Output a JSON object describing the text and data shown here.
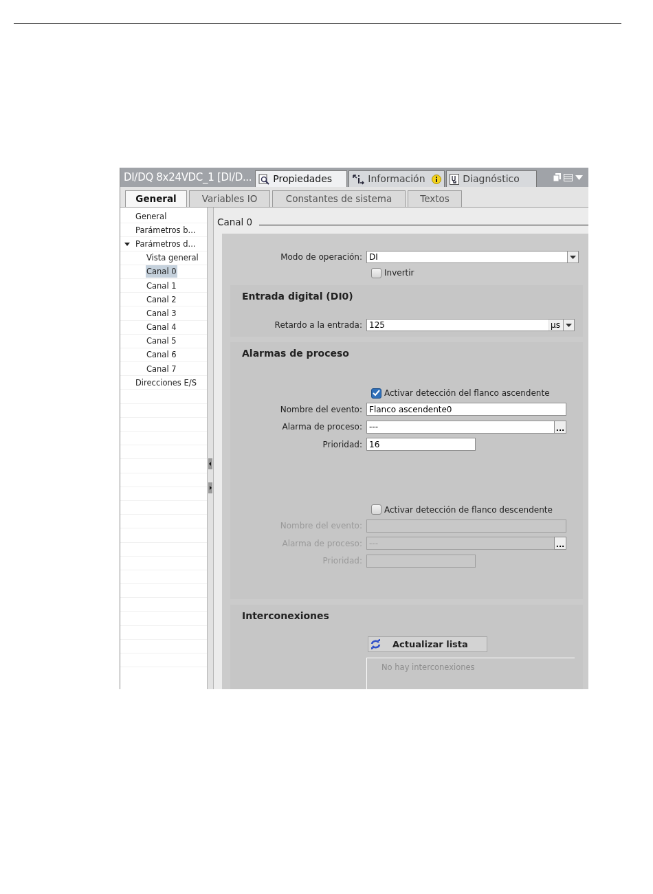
{
  "header": {
    "title": "DI/DQ 8x24VDC_1 [DI/D...",
    "tabs": [
      {
        "label": "Propiedades",
        "selected": true,
        "kind": "properties",
        "badge": false
      },
      {
        "label": "Información",
        "selected": false,
        "kind": "info",
        "badge": true
      },
      {
        "label": "Diagnóstico",
        "selected": false,
        "kind": "diagnostics",
        "badge": false
      }
    ]
  },
  "subtabs": [
    {
      "label": "General",
      "selected": true
    },
    {
      "label": "Variables IO",
      "selected": false
    },
    {
      "label": "Constantes de sistema",
      "selected": false
    },
    {
      "label": "Textos",
      "selected": false
    }
  ],
  "tree": [
    {
      "label": "General",
      "selected": false
    },
    {
      "label": "Parámetros b...",
      "selected": false
    },
    {
      "label": "Parámetros d...",
      "selected": false,
      "expanded": true,
      "children": [
        {
          "label": "Vista general",
          "selected": false
        },
        {
          "label": "Canal 0",
          "selected": true
        },
        {
          "label": "Canal 1",
          "selected": false
        },
        {
          "label": "Canal 2",
          "selected": false
        },
        {
          "label": "Canal 3",
          "selected": false
        },
        {
          "label": "Canal 4",
          "selected": false
        },
        {
          "label": "Canal 5",
          "selected": false
        },
        {
          "label": "Canal 6",
          "selected": false
        },
        {
          "label": "Canal 7",
          "selected": false
        }
      ]
    },
    {
      "label": "Direcciones E/S",
      "selected": false
    }
  ],
  "page_title": "Canal 0",
  "sections": [
    {
      "rows": [
        {
          "kind": "select",
          "label": "Modo de operación:",
          "value": "DI"
        },
        {
          "kind": "checkbox",
          "label": "Invertir",
          "checked": false
        }
      ]
    },
    {
      "title": "Entrada digital (DI0)",
      "rows": [
        {
          "kind": "unit",
          "label": "Retardo a la entrada:",
          "value": "125",
          "unit": "μs"
        }
      ]
    },
    {
      "title": "Alarmas de proceso",
      "rows": [
        {
          "kind": "checkbox",
          "label": "Activar detección del flanco ascendente",
          "checked": true
        },
        {
          "kind": "text",
          "label": "Nombre del evento:",
          "value": "Flanco ascendente0",
          "disabled": false
        },
        {
          "kind": "browse",
          "label": "Alarma de proceso:",
          "value": "---",
          "browse": "...",
          "disabled": false
        },
        {
          "kind": "short",
          "label": "Prioridad:",
          "value": "16",
          "disabled": false
        },
        {
          "kind": "spacer"
        },
        {
          "kind": "checkbox",
          "label": "Activar detección de flanco descendente",
          "checked": false
        },
        {
          "kind": "text",
          "label": "Nombre del evento:",
          "disabled": true
        },
        {
          "kind": "browse",
          "label": "Alarma de proceso:",
          "value": "---",
          "browse": "...",
          "disabled": true
        },
        {
          "kind": "short",
          "label": "Prioridad:",
          "disabled": true
        }
      ]
    },
    {
      "title": "Interconexiones",
      "rows": [
        {
          "kind": "button",
          "label": "Actualizar lista"
        },
        {
          "kind": "list",
          "placeholder": "No hay interconexiones"
        }
      ]
    }
  ]
}
